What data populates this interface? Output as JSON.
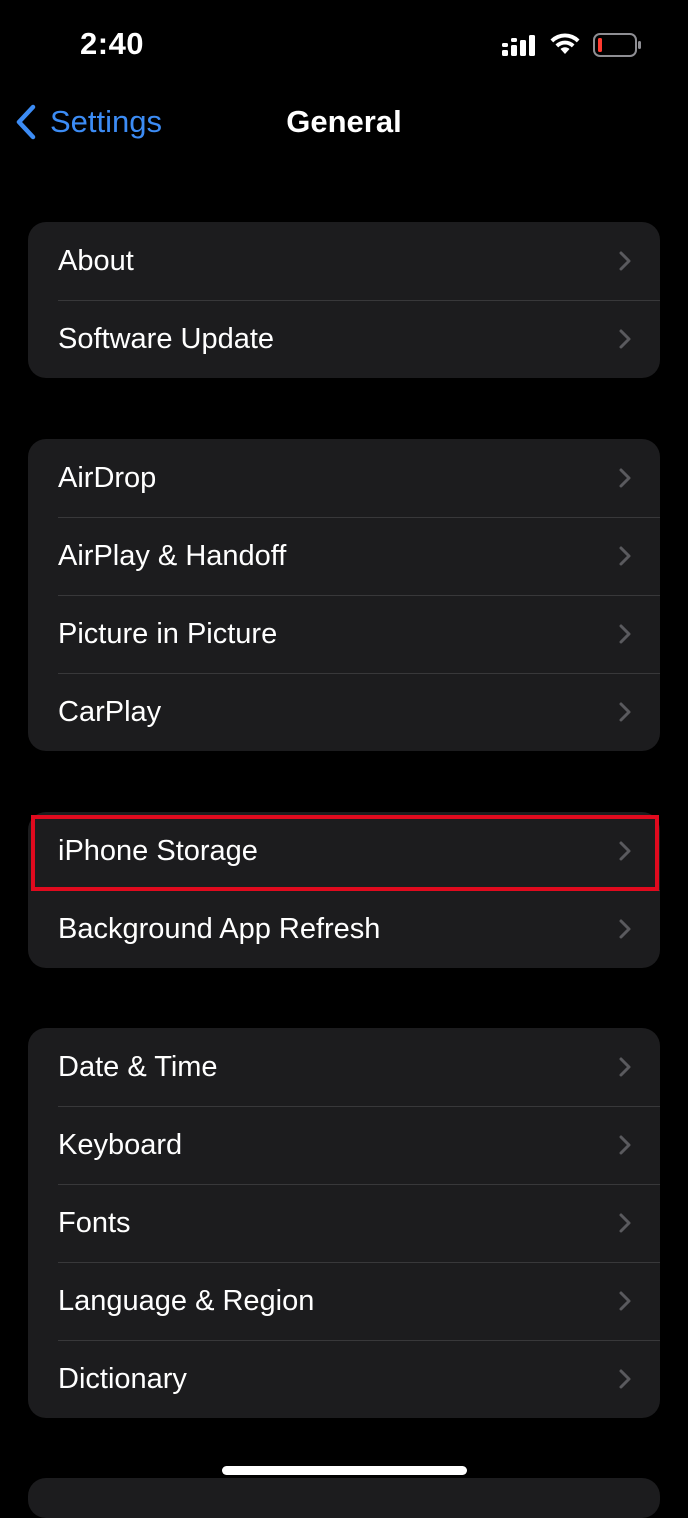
{
  "status_bar": {
    "time": "2:40",
    "icons": [
      "cellular-signal-icon",
      "wifi-icon",
      "battery-low-icon"
    ],
    "battery_color": "#ff3b30"
  },
  "nav": {
    "back_label": "Settings",
    "title": "General",
    "accent_color": "#3c8cf5"
  },
  "groups": [
    {
      "items": [
        {
          "label": "About"
        },
        {
          "label": "Software Update"
        }
      ]
    },
    {
      "items": [
        {
          "label": "AirDrop"
        },
        {
          "label": "AirPlay & Handoff"
        },
        {
          "label": "Picture in Picture"
        },
        {
          "label": "CarPlay"
        }
      ]
    },
    {
      "items": [
        {
          "label": "iPhone Storage"
        },
        {
          "label": "Background App Refresh"
        }
      ]
    },
    {
      "items": [
        {
          "label": "Date & Time"
        },
        {
          "label": "Keyboard"
        },
        {
          "label": "Fonts"
        },
        {
          "label": "Language & Region"
        },
        {
          "label": "Dictionary"
        }
      ]
    }
  ],
  "annotation": {
    "highlighted_item": "iPhone Storage",
    "color": "#e00a1e"
  }
}
